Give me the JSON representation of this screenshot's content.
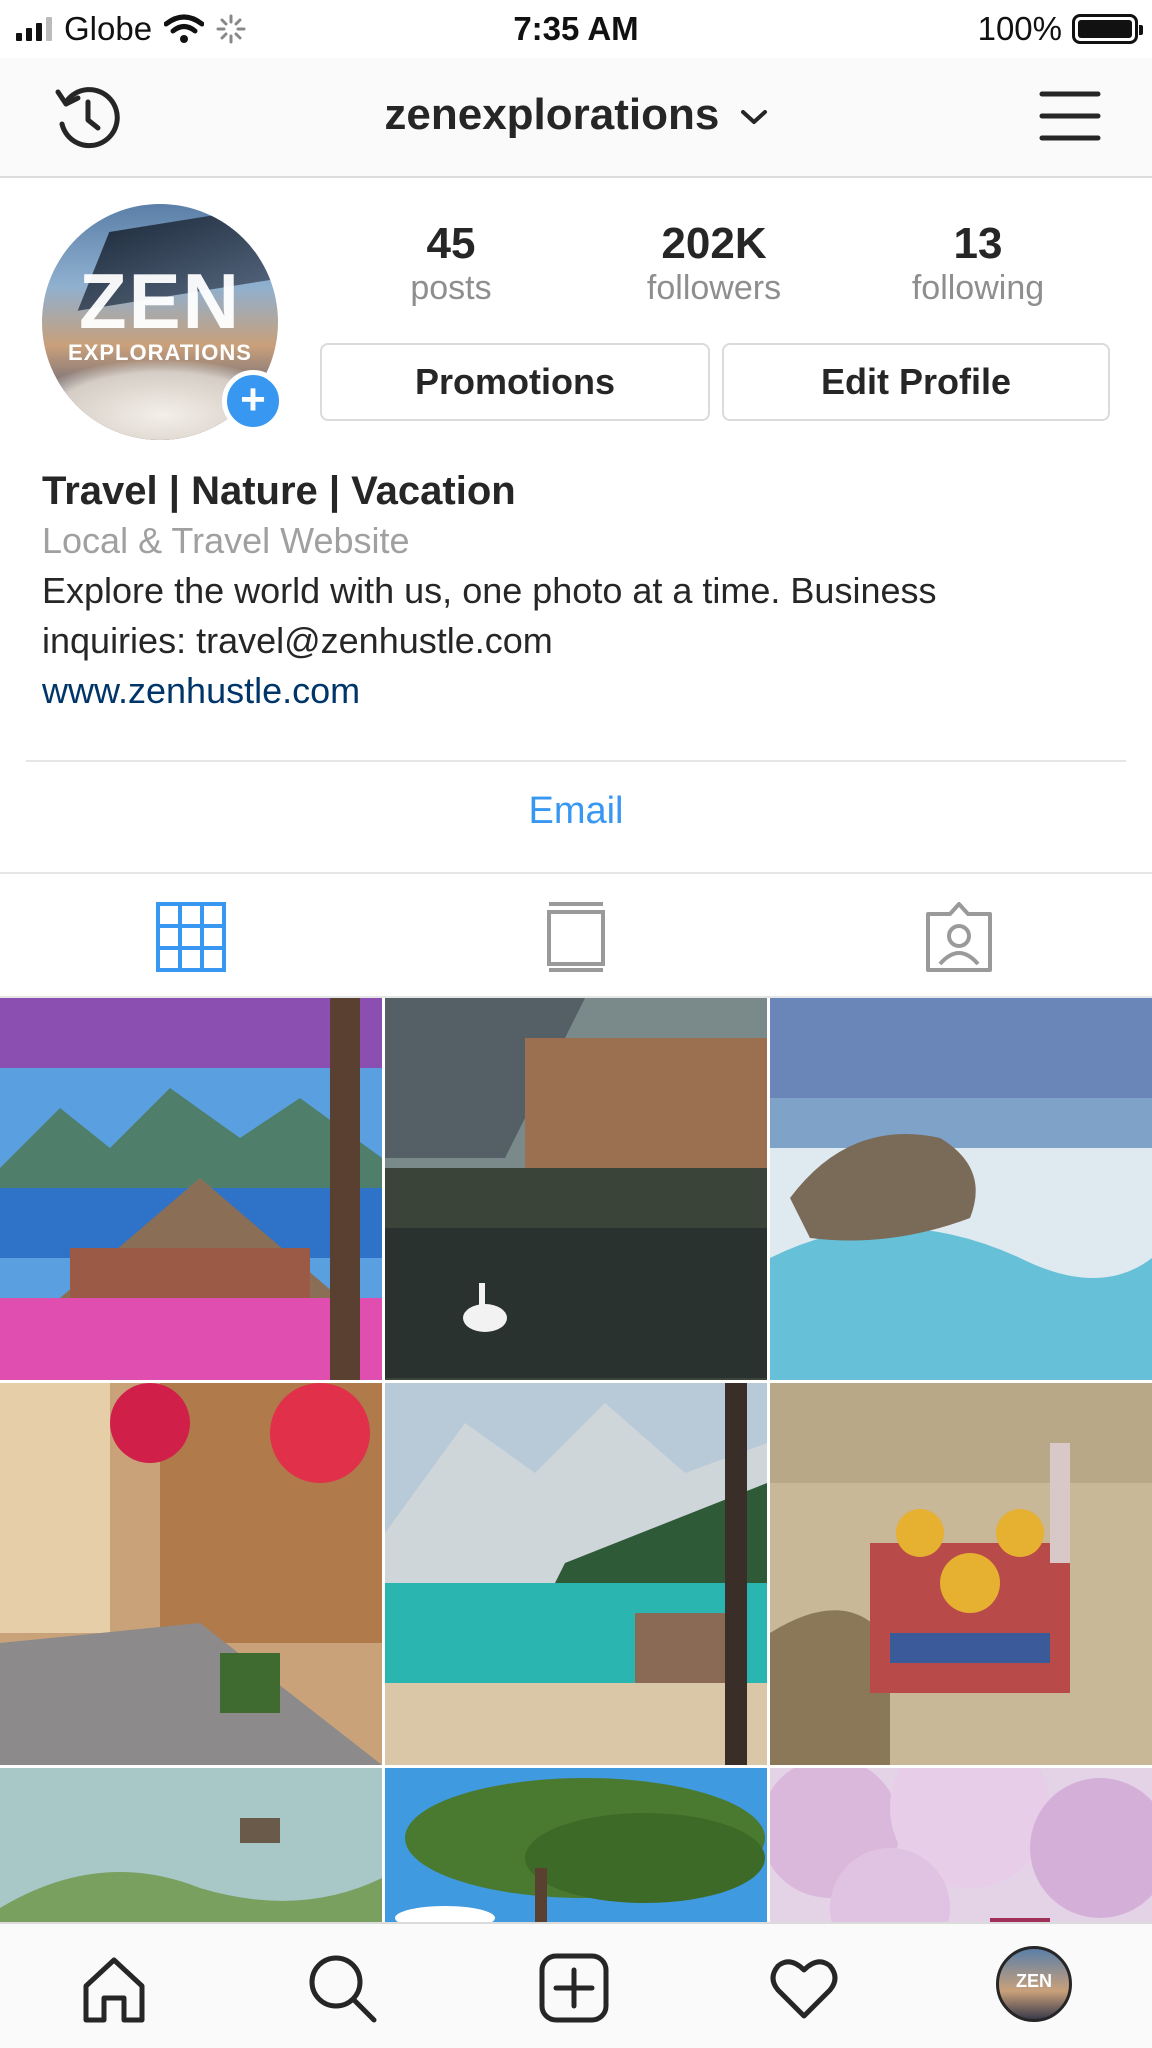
{
  "status_bar": {
    "carrier": "Globe",
    "time": "7:35 AM",
    "battery": "100%",
    "battery_level": 1.0
  },
  "header": {
    "username": "zenexplorations"
  },
  "profile": {
    "avatar_text_main": "ZEN",
    "avatar_text_sub": "EXPLORATIONS",
    "stats": [
      {
        "value": "45",
        "label": "posts"
      },
      {
        "value": "202K",
        "label": "followers"
      },
      {
        "value": "13",
        "label": "following"
      }
    ],
    "buttons": {
      "promotions": "Promotions",
      "edit_profile": "Edit Profile"
    },
    "name": "Travel | Nature | Vacation",
    "category": "Local & Travel Website",
    "bio_line1": "Explore the world with us, one photo at a time. Business",
    "bio_line2": "inquiries: travel@zenhustle.com",
    "website": "www.zenhustle.com",
    "contact_button": "Email"
  },
  "tabs": [
    {
      "icon": "grid-icon",
      "active": true
    },
    {
      "icon": "feed-icon",
      "active": false
    },
    {
      "icon": "tagged-icon",
      "active": false
    }
  ],
  "grid_tiles": [
    {
      "subject": "wisteria-lake-cottage"
    },
    {
      "subject": "hallstatt-lake-swan"
    },
    {
      "subject": "frozen-coast-boulder"
    },
    {
      "subject": "flower-street"
    },
    {
      "subject": "braies-lake-mountains"
    },
    {
      "subject": "golden-dome-church"
    },
    {
      "subject": "green-hills-castle"
    },
    {
      "subject": "pine-tree-sky"
    },
    {
      "subject": "cherry-blossom-forest"
    }
  ],
  "bottom_nav": [
    "home-icon",
    "search-icon",
    "add-post-icon",
    "activity-heart-icon",
    "profile-avatar"
  ],
  "colors": {
    "accent": "#3897f0",
    "link": "#003569",
    "text": "#262626",
    "muted": "#8e8e8e"
  }
}
